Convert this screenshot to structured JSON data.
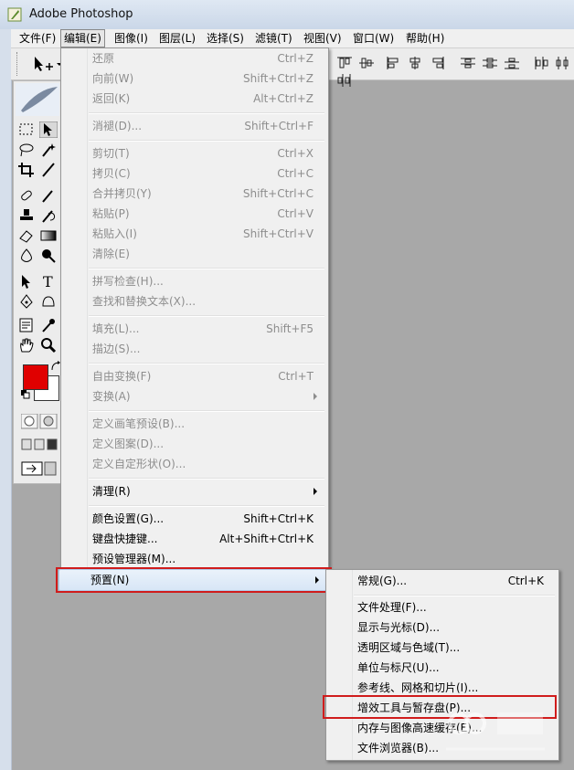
{
  "window": {
    "title": "Adobe Photoshop",
    "icon": "photoshop-feather-icon"
  },
  "menubar": {
    "items": [
      {
        "label": "文件(F)"
      },
      {
        "label": "编辑(E)"
      },
      {
        "label": "图像(I)"
      },
      {
        "label": "图层(L)"
      },
      {
        "label": "选择(S)"
      },
      {
        "label": "滤镜(T)"
      },
      {
        "label": "视图(V)"
      },
      {
        "label": "窗口(W)"
      },
      {
        "label": "帮助(H)"
      }
    ]
  },
  "edit_menu": {
    "items": [
      {
        "label": "还原",
        "shortcut": "Ctrl+Z",
        "disabled": true
      },
      {
        "label": "向前(W)",
        "shortcut": "Shift+Ctrl+Z",
        "disabled": true
      },
      {
        "label": "返回(K)",
        "shortcut": "Alt+Ctrl+Z",
        "disabled": true
      },
      {
        "label": "消褪(D)...",
        "shortcut": "Shift+Ctrl+F",
        "disabled": true
      },
      {
        "label": "剪切(T)",
        "shortcut": "Ctrl+X",
        "disabled": true
      },
      {
        "label": "拷贝(C)",
        "shortcut": "Ctrl+C",
        "disabled": true
      },
      {
        "label": "合并拷贝(Y)",
        "shortcut": "Shift+Ctrl+C",
        "disabled": true
      },
      {
        "label": "粘贴(P)",
        "shortcut": "Ctrl+V",
        "disabled": true
      },
      {
        "label": "粘贴入(I)",
        "shortcut": "Shift+Ctrl+V",
        "disabled": true
      },
      {
        "label": "清除(E)",
        "shortcut": "",
        "disabled": true
      },
      {
        "label": "拼写检查(H)...",
        "shortcut": "",
        "disabled": true
      },
      {
        "label": "查找和替换文本(X)...",
        "shortcut": "",
        "disabled": true
      },
      {
        "label": "填充(L)...",
        "shortcut": "Shift+F5",
        "disabled": true
      },
      {
        "label": "描边(S)...",
        "shortcut": "",
        "disabled": true
      },
      {
        "label": "自由变换(F)",
        "shortcut": "Ctrl+T",
        "disabled": true
      },
      {
        "label": "变换(A)",
        "shortcut": "",
        "disabled": true
      },
      {
        "label": "定义画笔预设(B)...",
        "shortcut": "",
        "disabled": true
      },
      {
        "label": "定义图案(D)...",
        "shortcut": "",
        "disabled": true
      },
      {
        "label": "定义自定形状(O)...",
        "shortcut": "",
        "disabled": true
      },
      {
        "label": "清理(R)",
        "shortcut": "",
        "disabled": false
      },
      {
        "label": "颜色设置(G)...",
        "shortcut": "Shift+Ctrl+K",
        "disabled": false
      },
      {
        "label": "键盘快捷键...",
        "shortcut": "Alt+Shift+Ctrl+K",
        "disabled": false
      },
      {
        "label": "预设管理器(M)...",
        "shortcut": "",
        "disabled": false
      },
      {
        "label": "预置(N)",
        "shortcut": "",
        "disabled": false
      }
    ]
  },
  "prefs_submenu": {
    "items": [
      {
        "label": "常规(G)...",
        "shortcut": "Ctrl+K"
      },
      {
        "label": "文件处理(F)...",
        "shortcut": ""
      },
      {
        "label": "显示与光标(D)...",
        "shortcut": ""
      },
      {
        "label": "透明区域与色域(T)...",
        "shortcut": ""
      },
      {
        "label": "单位与标尺(U)...",
        "shortcut": ""
      },
      {
        "label": "参考线、网格和切片(I)...",
        "shortcut": ""
      },
      {
        "label": "增效工具与暂存盘(P)...",
        "shortcut": ""
      },
      {
        "label": "内存与图像高速缓存(E)...",
        "shortcut": ""
      },
      {
        "label": "文件浏览器(B)...",
        "shortcut": ""
      }
    ]
  },
  "colors": {
    "foreground": "#e00000",
    "background": "#ffffff",
    "highlight_box": "#d01c1c"
  }
}
